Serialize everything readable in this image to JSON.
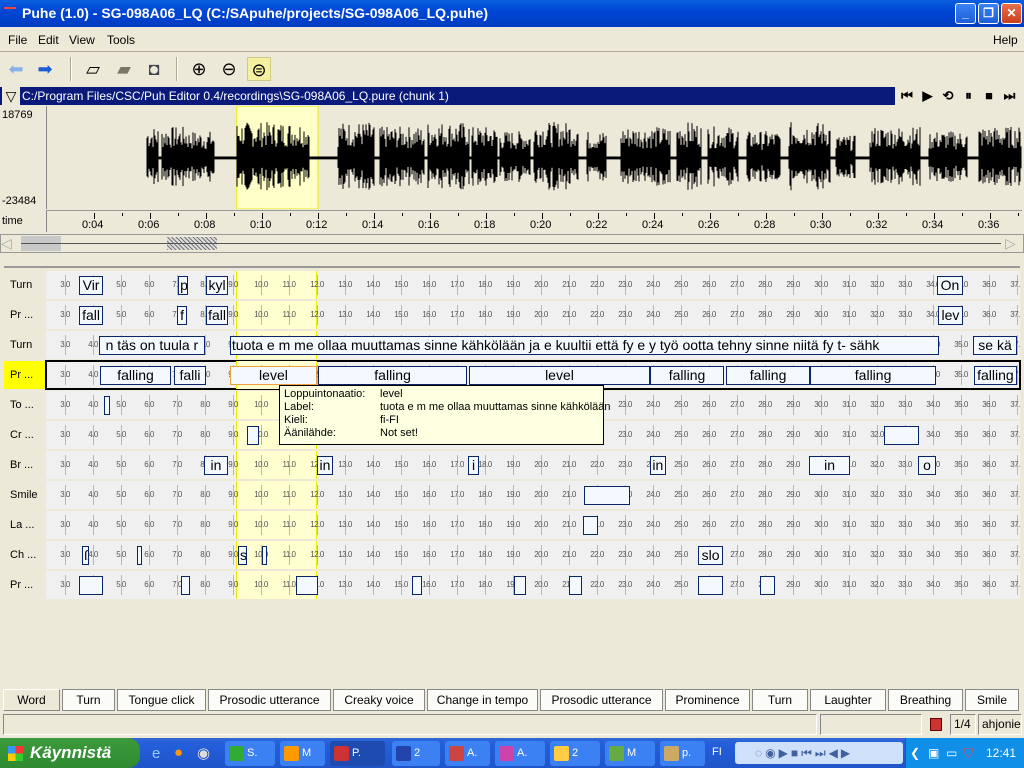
{
  "window": {
    "title": "Puhe (1.0) - SG-098A06_LQ (C:/SApuhe/projects/SG-098A06_LQ.puhe)",
    "minimize": "_",
    "restore": "❐",
    "close": "✕"
  },
  "menu": {
    "file": "File",
    "edit": "Edit",
    "view": "View",
    "tools": "Tools",
    "help": "Help"
  },
  "toolbar": {
    "icons": [
      "back-arrow-icon",
      "forward-arrow-icon",
      "new-file-icon",
      "open-folder-icon",
      "save-disk-icon",
      "zoom-in-icon",
      "zoom-out-icon",
      "zoom-fit-icon"
    ]
  },
  "recording": {
    "path": "C:/Program Files/CSC/Puh Editor 0.4/recordings\\SG-098A06_LQ.pure (chunk 1)",
    "ymax": "18769",
    "ymin": "-23484",
    "time_label": "time",
    "time_ticks": [
      "0:04",
      "0:06",
      "0:08",
      "0:10",
      "0:12",
      "0:14",
      "0:16",
      "0:18",
      "0:20",
      "0:22",
      "0:24",
      "0:26",
      "0:28",
      "0:30",
      "0:32",
      "0:34",
      "0:36"
    ],
    "selection_seconds": [
      9.1,
      12.0
    ]
  },
  "transport": [
    "⏮",
    "▶",
    "⟲",
    "⏸",
    "■",
    "⏭"
  ],
  "tier_ticks": [
    "3.0",
    "4.0",
    "5.0",
    "6.0",
    "7.0",
    "8.0",
    "9.0",
    "10.0",
    "11.0",
    "12.0",
    "13.0",
    "14.0",
    "15.0",
    "16.0",
    "17.0",
    "18.0",
    "19.0",
    "20.0",
    "21.0",
    "22.0",
    "23.0",
    "24.0",
    "25.0",
    "26.0",
    "27.0",
    "28.0",
    "29.0",
    "30.0",
    "31.0",
    "32.0",
    "33.0",
    "34.0",
    "35.0",
    "36.0",
    "37.0"
  ],
  "tiers": [
    {
      "label": "Turn",
      "segments": [
        {
          "s": 3.5,
          "e": 4.36,
          "t": "Vir"
        },
        {
          "s": 7.04,
          "e": 7.39,
          "t": "p"
        },
        {
          "s": 8.04,
          "e": 8.82,
          "t": "kyl"
        },
        {
          "s": 34.14,
          "e": 35.07,
          "t": "On"
        }
      ]
    },
    {
      "label": "Pr ...",
      "segments": [
        {
          "s": 3.5,
          "e": 4.36,
          "t": "fall"
        },
        {
          "s": 7.0,
          "e": 7.36,
          "t": "f"
        },
        {
          "s": 8.04,
          "e": 8.82,
          "t": "fall"
        },
        {
          "s": 34.18,
          "e": 35.07,
          "t": "lev"
        }
      ]
    },
    {
      "label": "Turn",
      "segments": [
        {
          "s": 4.21,
          "e": 8.0,
          "t": "n täs on tuula r"
        },
        {
          "s": 8.89,
          "e": 34.21,
          "t": "tuota e m me ollaa muuttamas sinne kähkölään ja e kuultii että fy e y työ ootta tehny sinne niitä fy t- sähk"
        },
        {
          "s": 35.43,
          "e": 37.0,
          "t": "se kä"
        }
      ]
    },
    {
      "label": "Pr ...",
      "selected": true,
      "segments": [
        {
          "s": 4.25,
          "e": 6.79,
          "t": "falling"
        },
        {
          "s": 6.89,
          "e": 8.04,
          "t": "falli"
        },
        {
          "s": 8.89,
          "e": 12.0,
          "t": "level",
          "active": true
        },
        {
          "s": 12.04,
          "e": 17.36,
          "t": "falling"
        },
        {
          "s": 17.43,
          "e": 23.89,
          "t": "level"
        },
        {
          "s": 23.89,
          "e": 26.54,
          "t": "falling"
        },
        {
          "s": 26.61,
          "e": 29.61,
          "t": "falling"
        },
        {
          "s": 29.61,
          "e": 34.11,
          "t": "falling"
        },
        {
          "s": 35.46,
          "e": 37.0,
          "t": "falling"
        }
      ]
    },
    {
      "label": "To ...",
      "segments": [
        {
          "s": 4.39,
          "e": 4.61,
          "t": ""
        }
      ]
    },
    {
      "label": "Cr ...",
      "segments": [
        {
          "s": 9.5,
          "e": 9.93,
          "t": ""
        },
        {
          "s": 32.25,
          "e": 33.5,
          "t": ""
        }
      ]
    },
    {
      "label": "Br ...",
      "segments": [
        {
          "s": 7.96,
          "e": 8.82,
          "t": "in"
        },
        {
          "s": 12.0,
          "e": 12.57,
          "t": "in"
        },
        {
          "s": 17.39,
          "e": 17.79,
          "t": "i"
        },
        {
          "s": 23.89,
          "e": 24.46,
          "t": "in"
        },
        {
          "s": 29.57,
          "e": 31.04,
          "t": "in"
        },
        {
          "s": 33.46,
          "e": 34.11,
          "t": "o"
        }
      ]
    },
    {
      "label": "Smile",
      "segments": [
        {
          "s": 21.54,
          "e": 23.18,
          "t": ""
        }
      ]
    },
    {
      "label": "La ...",
      "segments": [
        {
          "s": 21.5,
          "e": 22.04,
          "t": ""
        }
      ]
    },
    {
      "label": "Ch ...",
      "segments": [
        {
          "s": 3.61,
          "e": 3.86,
          "t": "ß"
        },
        {
          "s": 5.57,
          "e": 5.75,
          "t": ""
        },
        {
          "s": 9.18,
          "e": 9.5,
          "t": "s"
        },
        {
          "s": 10.04,
          "e": 10.21,
          "t": ""
        },
        {
          "s": 25.61,
          "e": 26.5,
          "t": "slo"
        }
      ]
    },
    {
      "label": "Pr ...",
      "segments": [
        {
          "s": 3.5,
          "e": 4.36,
          "t": ""
        },
        {
          "s": 7.14,
          "e": 7.46,
          "t": ""
        },
        {
          "s": 11.25,
          "e": 12.04,
          "t": ""
        },
        {
          "s": 15.39,
          "e": 15.75,
          "t": ""
        },
        {
          "s": 19.04,
          "e": 19.46,
          "t": ""
        },
        {
          "s": 21.0,
          "e": 21.46,
          "t": ""
        },
        {
          "s": 25.61,
          "e": 26.5,
          "t": ""
        },
        {
          "s": 27.82,
          "e": 28.36,
          "t": ""
        }
      ]
    }
  ],
  "tooltip": {
    "k1": "Loppuintonaatio:",
    "v1": "level",
    "k2": "Label:",
    "v2": "tuota e m me ollaa muuttamas sinne kähkölään",
    "k3": "Kieli:",
    "v3": "fi-FI",
    "k4": "Äänilähde:",
    "v4": "Not set!"
  },
  "tabs": [
    "Word",
    "Turn",
    "Tongue click",
    "Prosodic utterance",
    "Creaky voice",
    "Change in tempo",
    "Prosodic utterance",
    "Prominence",
    "Turn",
    "Laughter",
    "Breathing",
    "Smile"
  ],
  "status": {
    "main": "",
    "page": "1/4",
    "user": "ahjonie"
  },
  "taskbar": {
    "start": "Käynnistä",
    "tasks": [
      "S.",
      "M",
      "P.",
      "2",
      "A.",
      "A.",
      "2",
      "M",
      "p."
    ],
    "lang": "FI",
    "clock": "12:41"
  },
  "colors": {
    "title_blue": "#0046d5",
    "path_bar": "#0a1a7a",
    "selected_tier": "#ffff00",
    "selection": "#ffffd0",
    "segment_border": "#0a246a"
  }
}
